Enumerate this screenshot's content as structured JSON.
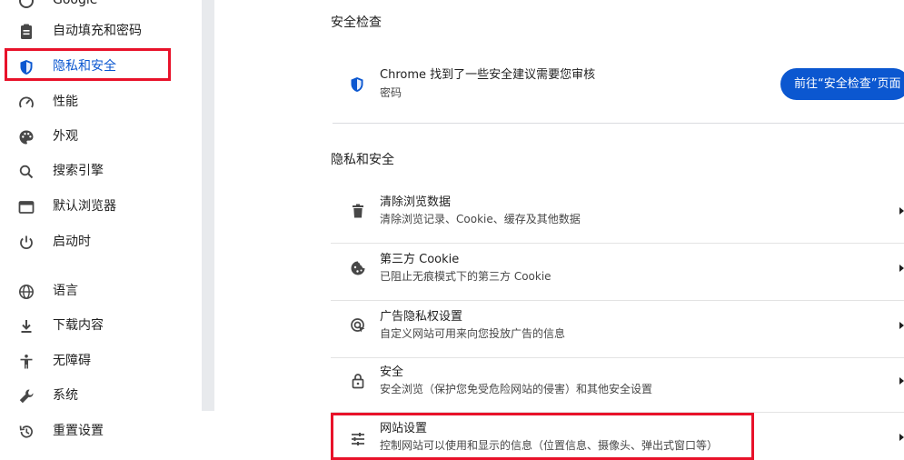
{
  "sidebar": {
    "items": [
      {
        "label": "Google",
        "icon": "google-icon"
      },
      {
        "label": "自动填充和密码",
        "icon": "clipboard-icon"
      },
      {
        "label": "隐私和安全",
        "icon": "shield-icon",
        "active": true
      },
      {
        "label": "性能",
        "icon": "speedometer-icon"
      },
      {
        "label": "外观",
        "icon": "palette-icon"
      },
      {
        "label": "搜索引擎",
        "icon": "search-icon"
      },
      {
        "label": "默认浏览器",
        "icon": "browser-window-icon"
      },
      {
        "label": "启动时",
        "icon": "power-icon"
      },
      {
        "label": "语言",
        "icon": "globe-icon"
      },
      {
        "label": "下载内容",
        "icon": "download-icon"
      },
      {
        "label": "无障碍",
        "icon": "accessibility-icon"
      },
      {
        "label": "系统",
        "icon": "wrench-icon"
      },
      {
        "label": "重置设置",
        "icon": "reset-history-icon"
      }
    ]
  },
  "safety_check": {
    "title": "安全检查",
    "message": "Chrome 找到了一些安全建议需要您审核",
    "detail": "密码",
    "button_label": "前往“安全检查”页面"
  },
  "privacy": {
    "title": "隐私和安全",
    "rows": [
      {
        "title": "清除浏览数据",
        "subtitle": "清除浏览记录、Cookie、缓存及其他数据",
        "icon": "trash-icon"
      },
      {
        "title": "第三方 Cookie",
        "subtitle": "已阻止无痕模式下的第三方 Cookie",
        "icon": "cookie-icon"
      },
      {
        "title": "广告隐私权设置",
        "subtitle": "自定义网站可用来向您投放广告的信息",
        "icon": "ad-privacy-icon"
      },
      {
        "title": "安全",
        "subtitle": "安全浏览（保护您免受危险网站的侵害）和其他安全设置",
        "icon": "lock-icon"
      },
      {
        "title": "网站设置",
        "subtitle": "控制网站可以使用和显示的信息（位置信息、摄像头、弹出式窗口等）",
        "icon": "tune-sliders-icon"
      }
    ]
  },
  "colors": {
    "accent": "#0b57d0",
    "highlight_box": "#e8122a"
  }
}
